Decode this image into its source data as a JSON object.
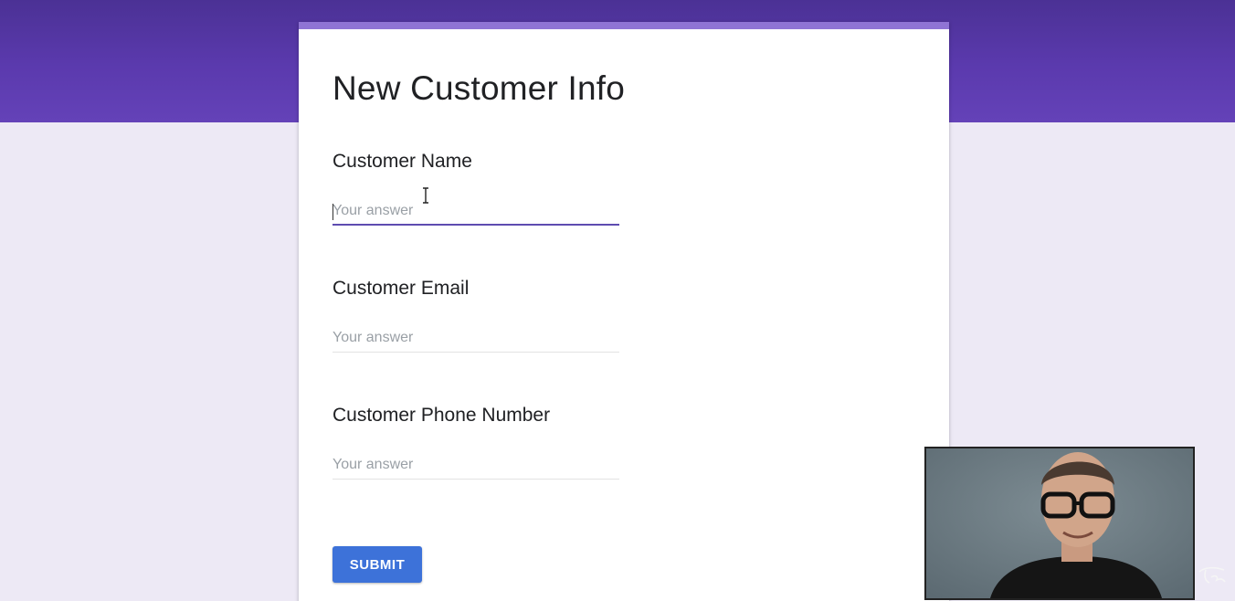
{
  "form": {
    "title": "New Customer Info",
    "questions": [
      {
        "label": "Customer Name",
        "placeholder": "Your answer",
        "focused": true
      },
      {
        "label": "Customer Email",
        "placeholder": "Your answer"
      },
      {
        "label": "Customer Phone Number",
        "placeholder": "Your answer"
      }
    ],
    "submit_label": "SUBMIT"
  },
  "colors": {
    "header": "#5b3aae",
    "page_background": "#ede9f5",
    "accent_top_border": "#8f74d4",
    "focused_underline": "#5e4cb0",
    "submit_button": "#3d72d9"
  },
  "icons": [
    "text-cursor-icon",
    "watermark-logo"
  ],
  "overlay": {
    "type": "webcam-video"
  }
}
